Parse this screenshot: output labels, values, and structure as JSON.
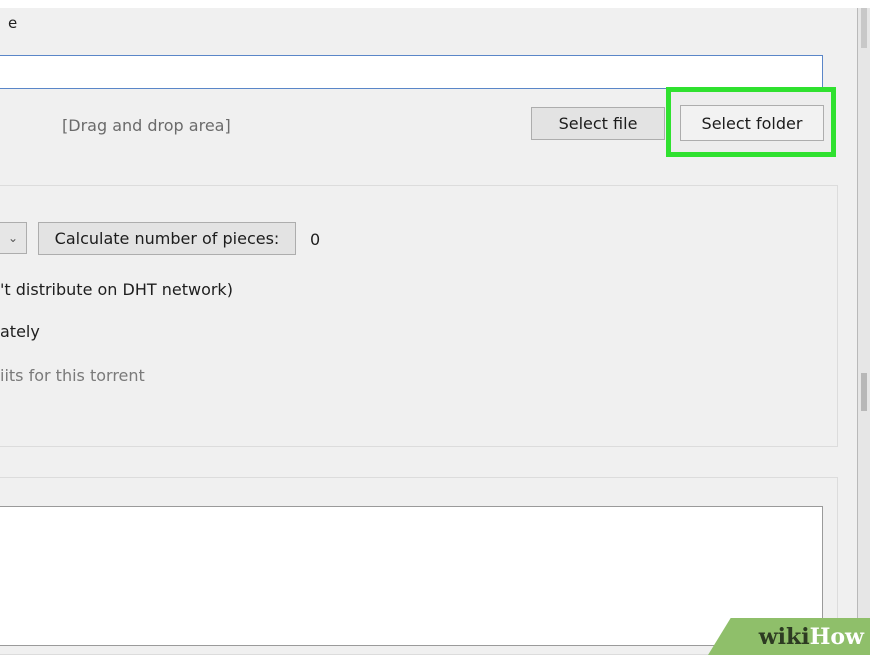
{
  "header": {
    "title_fragment": "e"
  },
  "file_section": {
    "drop_area_label": "[Drag and drop area]",
    "select_file_label": "Select file",
    "select_folder_label": "Select folder"
  },
  "options": {
    "calculate_pieces_label": "Calculate number of pieces:",
    "pieces_count": "0",
    "dht_option": "'t distribute on DHT network)",
    "immediately_option": "ately",
    "limits_option": "iits for this torrent"
  },
  "watermark": {
    "wiki": "wiki",
    "how": "How"
  },
  "colors": {
    "highlight": "#2fe12f",
    "input_border": "#5a86c8",
    "watermark_bg": "#8fbf6a"
  },
  "icons": {
    "combo_dropdown": "chevron-down-icon"
  }
}
